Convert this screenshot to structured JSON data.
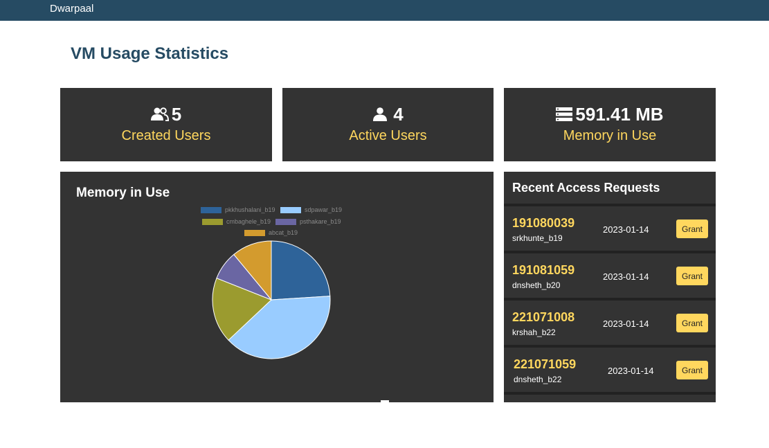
{
  "navbar": {
    "brand": "Dwarpaal"
  },
  "page": {
    "title": "VM Usage Statistics"
  },
  "stats": [
    {
      "icon": "users-icon",
      "value": "5",
      "label": "Created Users"
    },
    {
      "icon": "user-icon",
      "value": "4",
      "label": "Active Users"
    },
    {
      "icon": "server-icon",
      "value": "591.41 MB",
      "label": "Memory in Use"
    }
  ],
  "memory_panel": {
    "title": "Memory in Use"
  },
  "chart_data": {
    "type": "pie",
    "labels": [
      "pkkhushalani_b19",
      "sdpawar_b19",
      "cmbaghele_b19",
      "psthakare_b19",
      "abcat_b19"
    ],
    "values": [
      24,
      39,
      18,
      8,
      11
    ],
    "colors": [
      "#2e6399",
      "#99ccff",
      "#9b9b2f",
      "#6a66a3",
      "#d39b2e"
    ],
    "legend_position": "top"
  },
  "requests": {
    "title": "Recent Access Requests",
    "grant_label": "Grant",
    "items": [
      {
        "id": "191080039",
        "user": "srkhunte_b19",
        "date": "2023-01-14"
      },
      {
        "id": "191081059",
        "user": "dnsheth_b20",
        "date": "2023-01-14"
      },
      {
        "id": "221071008",
        "user": "krshah_b22",
        "date": "2023-01-14"
      },
      {
        "id": "221071059",
        "user": "dnsheth_b22",
        "date": "2023-01-14"
      }
    ]
  },
  "colors": {
    "navbar": "#264b63",
    "card": "#333333",
    "accent": "#ffd75e",
    "title": "#264b63"
  }
}
